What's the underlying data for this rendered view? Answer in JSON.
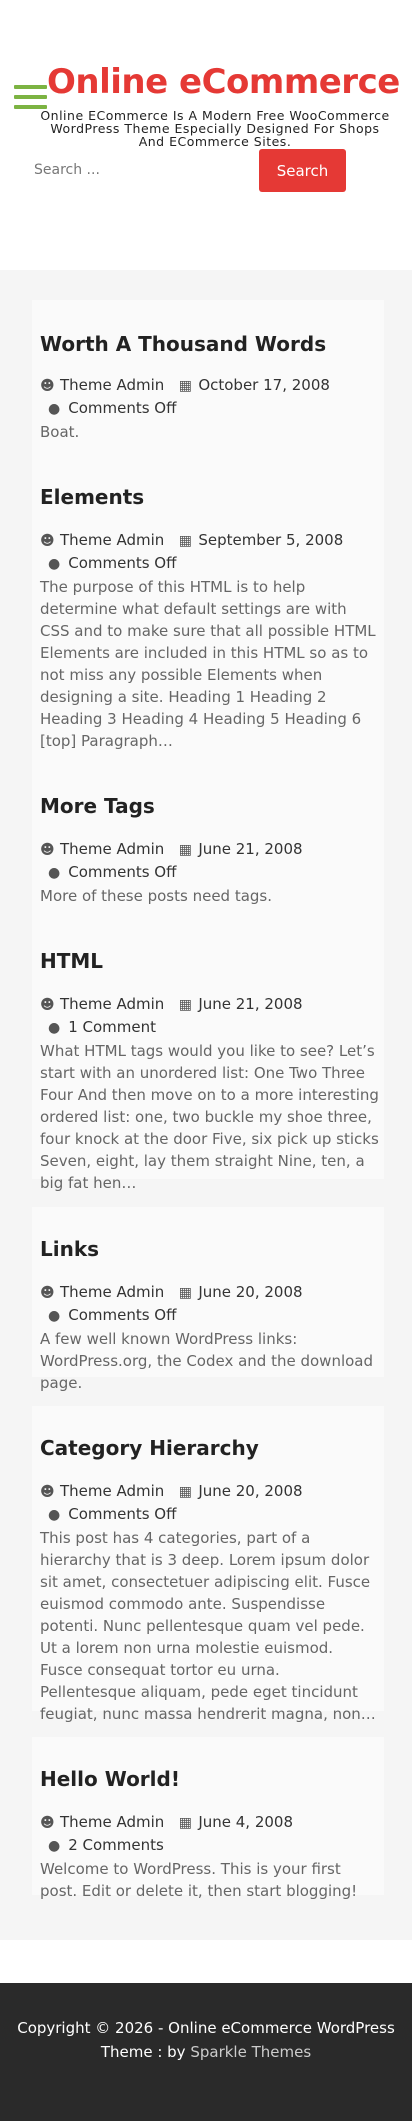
{
  "site": {
    "title": "Online eCommerce",
    "description": "Online ECommerce Is A Modern Free WooCommerce WordPress Theme Especially Designed For Shops And ECommerce Sites."
  },
  "search": {
    "placeholder": "Search ...",
    "button_label": "Search"
  },
  "icons": {
    "menu": "hamburger-icon",
    "user": "user-icon",
    "calendar": "calendar-icon",
    "comment": "comment-icon"
  },
  "colors": {
    "brand": "#e53935",
    "menu": "#7cb342",
    "footer_bg": "#2a2a2a"
  },
  "posts": [
    {
      "title": "Worth A Thousand Words",
      "author": "Theme Admin",
      "date": "October 17, 2008",
      "comments": "Comments Off",
      "excerpt": "Boat."
    },
    {
      "title": "Elements",
      "author": "Theme Admin",
      "date": "September 5, 2008",
      "comments": "Comments Off",
      "excerpt": "The purpose of this HTML is to help determine what default settings are with CSS and to make sure that all possible HTML Elements are included in this HTML so as to not miss any possible Elements when designing a site. Heading 1 Heading 2 Heading 3 Heading 4 Heading 5 Heading 6 [top] Paragraph…"
    },
    {
      "title": "More Tags",
      "author": "Theme Admin",
      "date": "June 21, 2008",
      "comments": "Comments Off",
      "excerpt": "More of these posts need tags."
    },
    {
      "title": "HTML",
      "author": "Theme Admin",
      "date": "June 21, 2008",
      "comments": "1 Comment",
      "excerpt": "What HTML tags would you like to see? Let’s start with an unordered list: One Two Three Four And then move on to a more interesting ordered list: one, two buckle my shoe three, four knock at the door Five, six pick up sticks Seven, eight, lay them straight Nine, ten, a big fat hen…"
    },
    {
      "title": "Links",
      "author": "Theme Admin",
      "date": "June 20, 2008",
      "comments": "Comments Off",
      "excerpt": "A few well known WordPress links: WordPress.org, the Codex and the download page."
    },
    {
      "title": "Category Hierarchy",
      "author": "Theme Admin",
      "date": "June 20, 2008",
      "comments": "Comments Off",
      "excerpt": "This post has 4 categories, part of a hierarchy that is 3 deep. Lorem ipsum dolor sit amet, consectetuer adipiscing elit. Fusce euismod commodo ante. Suspendisse potenti. Nunc pellentesque quam vel pede. Ut a lorem non urna molestie euismod. Fusce consequat tortor eu urna. Pellentesque aliquam, pede eget tincidunt feugiat, nunc massa hendrerit magna, non…"
    },
    {
      "title": "Hello World!",
      "author": "Theme Admin",
      "date": "June 4, 2008",
      "comments": "2 Comments",
      "excerpt": "Welcome to WordPress. This is your first post. Edit or delete it, then start blogging!"
    }
  ],
  "footer": {
    "copyright": "Copyright © 2026 - Online eCommerce WordPress Theme : by",
    "credit_link": "Sparkle Themes"
  }
}
